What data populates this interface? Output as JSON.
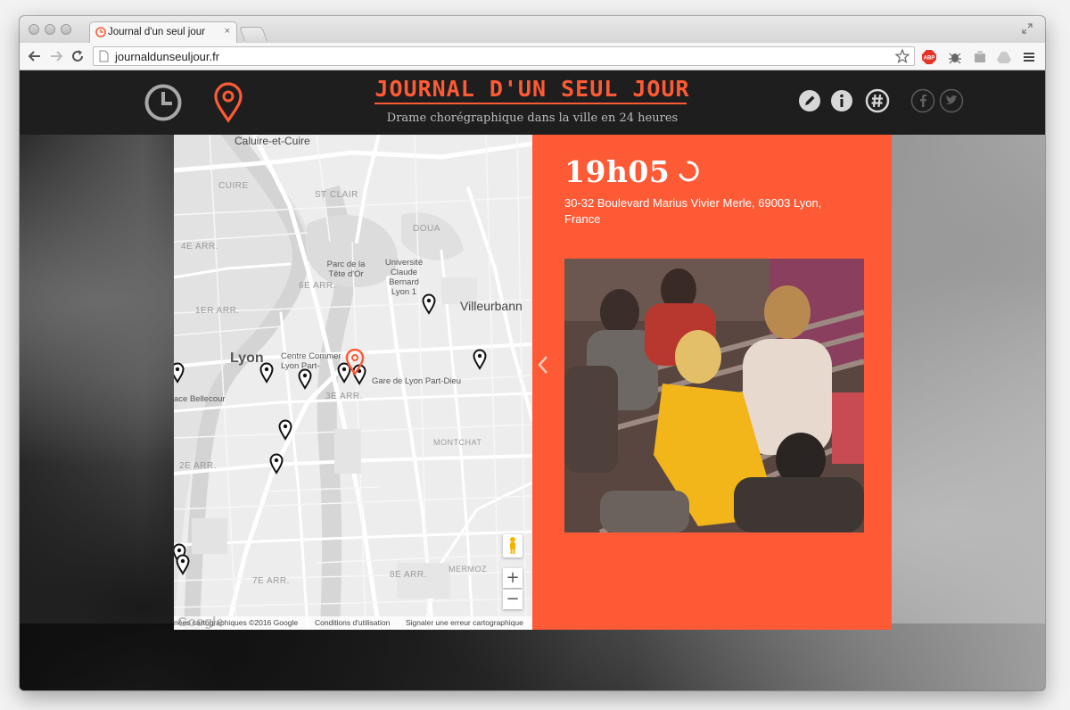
{
  "browser": {
    "tab_title": "Journal d'un seul jour",
    "tab_close": "×",
    "url": "journaldunseuljour.fr",
    "extensions": [
      "abp-icon",
      "bug-icon",
      "puzzle-icon",
      "drive-icon",
      "menu-icon"
    ],
    "abp_label": "ABP"
  },
  "header": {
    "title": "JOURNAL D'UN SEUL JOUR",
    "subtitle": "Drame chorégraphique dans la ville en 24 heures",
    "icons": [
      "clock-icon",
      "location-pin-icon",
      "pencil-icon",
      "info-icon",
      "hashtag-icon",
      "facebook-icon",
      "twitter-icon"
    ],
    "accent_color": "#ff5a36"
  },
  "map": {
    "cities": {
      "caluire": "Caluire-et-Cuire",
      "lyon": "Lyon",
      "villeurbanne": "Villeurbann"
    },
    "districts": {
      "cuire": "CUIRE",
      "st_clair": "ST CLAIR",
      "douai": "DOUA",
      "arr4": "4E ARR.",
      "arr6": "6E ARR.",
      "arr1": "1ER ARR.",
      "arr3": "3E ARR.",
      "arr2": "2E ARR.",
      "arr7": "7E ARR.",
      "arr8": "8E ARR.",
      "montchat": "MONTCHAT",
      "mermoz": "MERMOZ"
    },
    "pois": {
      "parc": "Parc de la\nTête d'Or",
      "universite": "Université\nClaude\nBernard\nLyon 1",
      "centre": "Centre Commer\nLyon Part-",
      "gare": "Gare de Lyon Part-Dieu",
      "bellecour": "ace Bellecour",
      "re": "re"
    },
    "zoom_in": "+",
    "zoom_out": "−",
    "footer": {
      "data": "nées cartographiques ©2016 Google",
      "terms": "Conditions d'utilisation",
      "report": "Signaler une erreur cartographique",
      "logo": "Google"
    },
    "marker_count": 12
  },
  "event": {
    "time": "19h05",
    "address": "30-32 Boulevard Marius Vivier Merle, 69003 Lyon, France"
  }
}
